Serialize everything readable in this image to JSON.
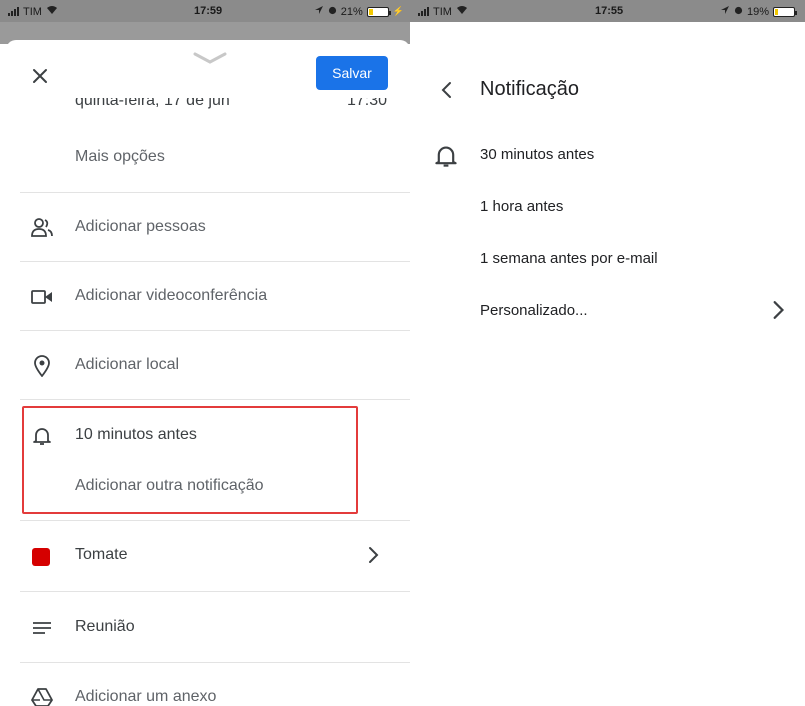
{
  "status_left": {
    "carrier": "TIM",
    "time": "17:59",
    "battery": "21%",
    "battery_level": 0.21
  },
  "status_right": {
    "carrier": "TIM",
    "time": "17:55",
    "battery": "19%",
    "battery_level": 0.19
  },
  "editor": {
    "save_label": "Salvar",
    "date_text": "quinta-feira, 17 de jun",
    "time_text": "17:30",
    "more_options": "Mais opções",
    "add_people": "Adicionar pessoas",
    "add_video": "Adicionar videoconferência",
    "add_location": "Adicionar local",
    "notification": "10 minutos antes",
    "add_notification": "Adicionar outra notificação",
    "color_name": "Tomate",
    "color_hex": "#d50000",
    "description": "Reunião",
    "add_attachment": "Adicionar um anexo"
  },
  "notification_screen": {
    "title": "Notificação",
    "options": [
      "30 minutos antes",
      "1 hora antes",
      "1 semana antes por e-mail",
      "Personalizado..."
    ]
  },
  "colors": {
    "accent": "#1a73e8",
    "highlight": "#e33b3b",
    "battery": "#f2c800"
  }
}
